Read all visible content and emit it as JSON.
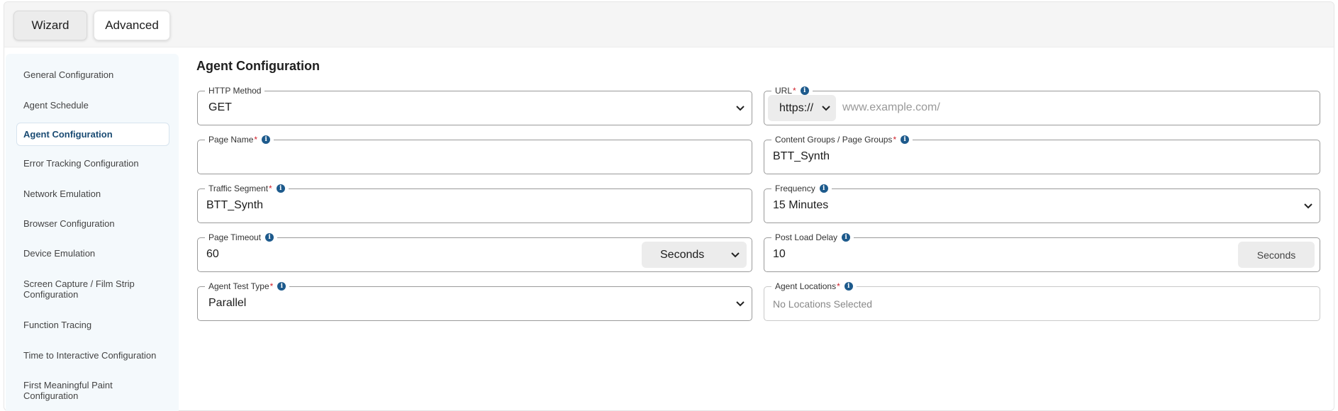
{
  "modes": {
    "wizard": "Wizard",
    "advanced": "Advanced"
  },
  "sidebar": {
    "items": [
      {
        "label": "General Configuration"
      },
      {
        "label": "Agent Schedule"
      },
      {
        "label": "Agent Configuration",
        "active": true
      },
      {
        "label": "Error Tracking Configuration"
      },
      {
        "label": "Network Emulation"
      },
      {
        "label": "Browser Configuration"
      },
      {
        "label": "Device Emulation"
      },
      {
        "label": "Screen Capture / Film Strip Configuration"
      },
      {
        "label": "Function Tracing"
      },
      {
        "label": "Time to Interactive Configuration"
      },
      {
        "label": "First Meaningful Paint Configuration"
      }
    ]
  },
  "main": {
    "title": "Agent Configuration",
    "fields": {
      "http_method": {
        "label": "HTTP Method",
        "value": "GET"
      },
      "url": {
        "label": "URL",
        "protocol": "https://",
        "placeholder": "www.example.com/"
      },
      "page_name": {
        "label": "Page Name",
        "value": ""
      },
      "content_groups": {
        "label": "Content Groups / Page Groups",
        "value": "BTT_Synth"
      },
      "traffic_segment": {
        "label": "Traffic Segment",
        "value": "BTT_Synth"
      },
      "frequency": {
        "label": "Frequency",
        "value": "15 Minutes"
      },
      "page_timeout": {
        "label": "Page Timeout",
        "value": "60",
        "unit": "Seconds"
      },
      "post_load_delay": {
        "label": "Post Load Delay",
        "value": "10",
        "unit": "Seconds"
      },
      "agent_test_type": {
        "label": "Agent Test Type",
        "value": "Parallel"
      },
      "agent_locations": {
        "label": "Agent Locations",
        "value": "No Locations Selected"
      }
    }
  },
  "colors": {
    "accent": "#1d5a8c",
    "required": "#d0202a",
    "sidebar_bg": "#f4f9fc"
  },
  "icons": {
    "info": "info-icon",
    "dropdown": "chevron-down-icon"
  }
}
